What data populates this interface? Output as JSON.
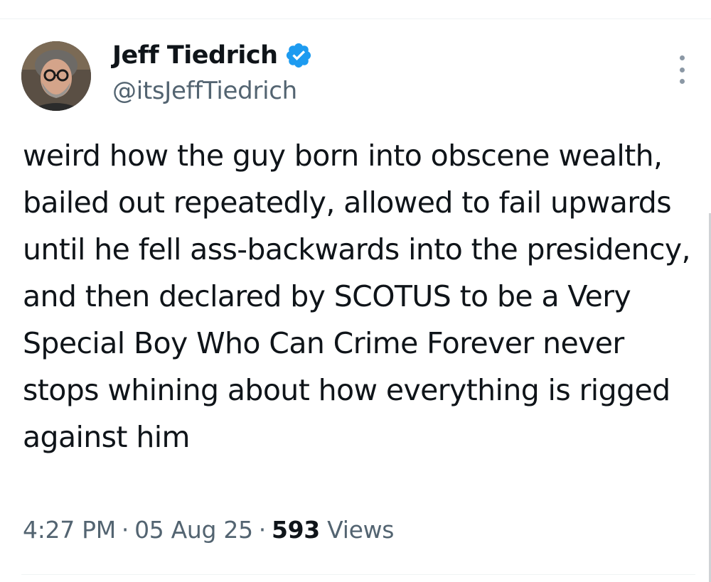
{
  "author": {
    "display_name": "Jeff Tiedrich",
    "handle": "@itsJeffTiedrich",
    "verified": true
  },
  "tweet": {
    "text": "weird how the guy born into obscene wealth, bailed out repeatedly, allowed to fail upwards until he fell ass-backwards into the presidency, and then declared by SCOTUS to be a Very Special Boy Who Can Crime Forever never stops whining about how everything is rigged against him",
    "time": "4:27 PM",
    "separator": "·",
    "date": "05 Aug 25",
    "views_count": "593",
    "views_label": "Views"
  },
  "icons": {
    "verified": "verified-badge-icon",
    "more": "more-options-icon"
  },
  "colors": {
    "accent": "#1d9bf0",
    "text": "#0f1419",
    "secondary": "#536471",
    "divider": "#eff3f4"
  }
}
